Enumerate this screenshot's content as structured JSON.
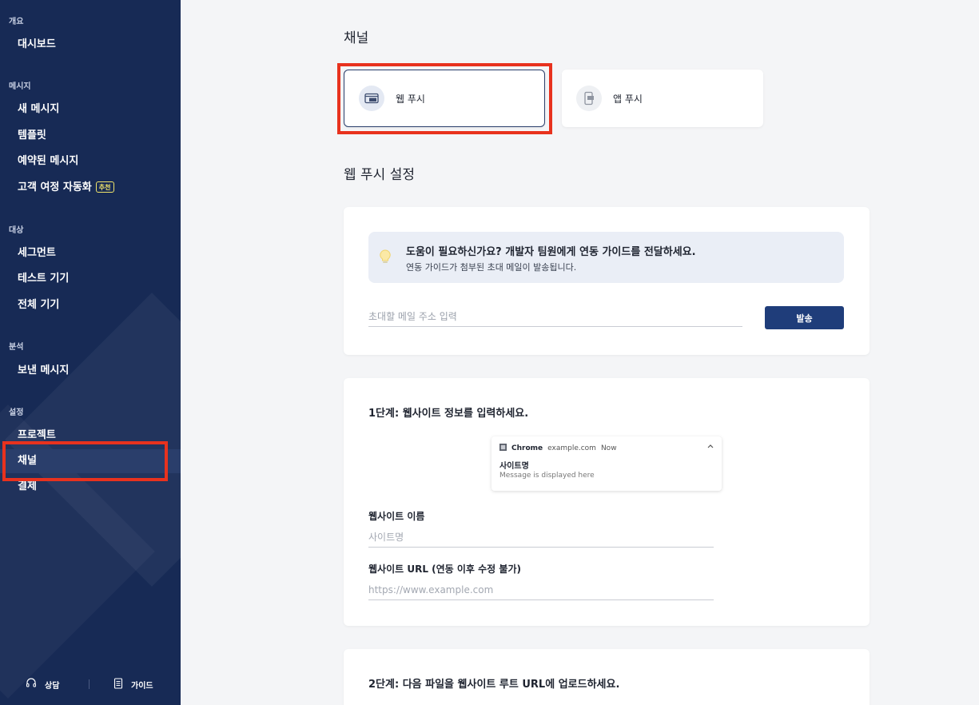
{
  "sidebar": {
    "sections": [
      {
        "label": "개요",
        "items": [
          {
            "label": "대시보드"
          }
        ]
      },
      {
        "label": "메시지",
        "items": [
          {
            "label": "새 메시지"
          },
          {
            "label": "템플릿"
          },
          {
            "label": "예약된 메시지"
          },
          {
            "label": "고객 여정 자동화",
            "badge": "추천"
          }
        ]
      },
      {
        "label": "대상",
        "items": [
          {
            "label": "세그먼트"
          },
          {
            "label": "테스트 기기"
          },
          {
            "label": "전체 기기"
          }
        ]
      },
      {
        "label": "분석",
        "items": [
          {
            "label": "보낸 메시지"
          }
        ]
      },
      {
        "label": "설정",
        "items": [
          {
            "label": "프로젝트"
          },
          {
            "label": "채널",
            "active": true
          },
          {
            "label": "결제"
          }
        ]
      }
    ],
    "footer": {
      "consult_label": "상담",
      "guide_label": "가이드"
    }
  },
  "main": {
    "title": "채널",
    "channels": [
      {
        "label": "웹 푸시",
        "selected": true,
        "icon": "browser-window-icon"
      },
      {
        "label": "앱 푸시",
        "selected": false,
        "icon": "mobile-app-icon"
      }
    ],
    "settings_title": "웹 푸시 설정",
    "help": {
      "title": "도움이 필요하신가요? 개발자 팀원에게 연동 가이드를 전달하세요.",
      "subtitle": "연동 가이드가 첨부된 초대 메일이 발송됩니다.",
      "email_placeholder": "초대할 메일 주소 입력",
      "send_label": "발송"
    },
    "step1": {
      "title": "1단계: 웹사이트 정보를 입력하세요.",
      "preview": {
        "browser": "Chrome",
        "domain": "example.com",
        "time": "Now",
        "title": "사이트명",
        "body": "Message is displayed here"
      },
      "site_name_label": "웹사이트 이름",
      "site_name_placeholder": "사이트명",
      "site_url_label": "웹사이트 URL (연동 이후 수정 불가)",
      "site_url_placeholder": "https://www.example.com"
    },
    "step2": {
      "title": "2단계: 다음 파일을 웹사이트 루트 URL에 업로드하세요."
    }
  },
  "colors": {
    "sidebar_bg": "#172a55",
    "primary_button": "#1f3d7a",
    "highlight": "#e8321e",
    "badge": "#f1e56a"
  }
}
